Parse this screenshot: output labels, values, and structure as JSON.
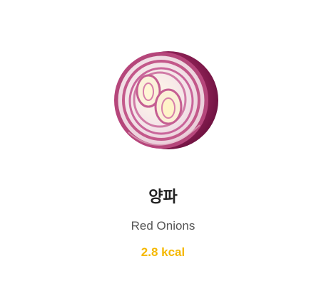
{
  "item": {
    "image_icon": "red-onion-half",
    "name_ko": "양파",
    "name_en": "Red Onions",
    "kcal": "2.8 kcal"
  },
  "colors": {
    "kcal": "#F5B800",
    "title": "#222222",
    "subtitle": "#555555",
    "onion_outer": "#8E1E55",
    "onion_inner": "#F4E7EA"
  }
}
